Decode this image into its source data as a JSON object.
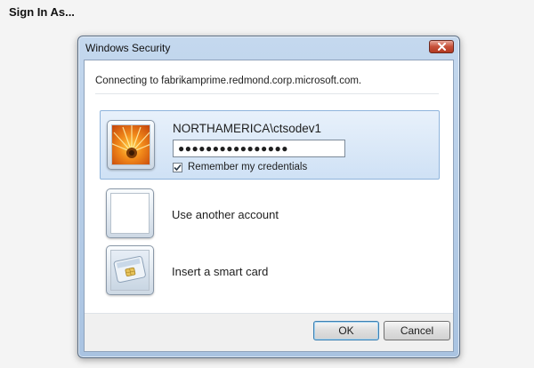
{
  "page": {
    "title": "Sign In As..."
  },
  "dialog": {
    "title": "Windows Security",
    "connecting_text": "Connecting to fabrikamprime.redmond.corp.microsoft.com.",
    "selected_tile": {
      "username": "NORTHAMERICA\\ctsodev1",
      "password_value": "●●●●●●●●●●●●●●●●",
      "remember_label": "Remember my credentials",
      "remember_checked": true
    },
    "tiles": [
      {
        "label": "Use another account",
        "icon": "blank-user-icon"
      },
      {
        "label": "Insert a smart card",
        "icon": "smart-card-icon"
      }
    ],
    "buttons": {
      "ok": "OK",
      "cancel": "Cancel"
    }
  }
}
